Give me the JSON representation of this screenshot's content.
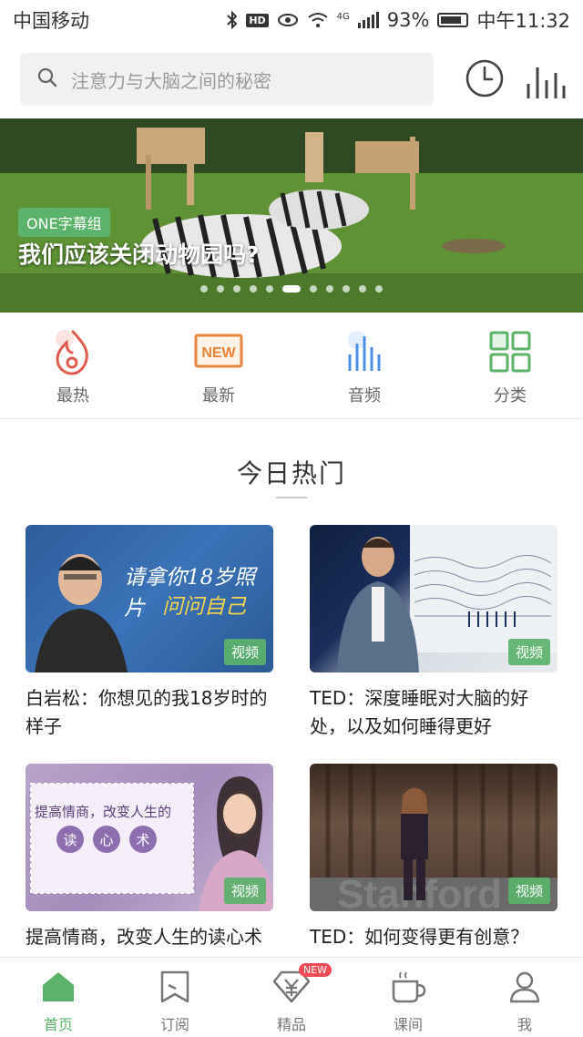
{
  "status_bar": {
    "carrier": "中国移动",
    "hd": "HD",
    "network": "4G",
    "battery": "93%",
    "time": "中午11:32"
  },
  "search": {
    "placeholder": "注意力与大脑之间的秘密"
  },
  "banner": {
    "tag": "ONE字幕组",
    "title": "我们应该关闭动物园吗?",
    "total_slides": 11,
    "active_slide": 5
  },
  "categories": [
    {
      "label": "最热",
      "icon": "flame-icon",
      "color": "#e05a4d"
    },
    {
      "label": "最新",
      "icon": "new-icon",
      "color": "#e8843a"
    },
    {
      "label": "音频",
      "icon": "audio-bars-icon",
      "color": "#4a8ee6"
    },
    {
      "label": "分类",
      "icon": "grid-icon",
      "color": "#5bb26a"
    }
  ],
  "section": {
    "title": "今日热门"
  },
  "cards": [
    {
      "title": "白岩松：你想见的我18岁时的样子",
      "badge": "视频",
      "thumb_text_1": "请拿你18岁照片",
      "thumb_text_2": "问问自己"
    },
    {
      "title": "TED：深度睡眠对大脑的好处，以及如何睡得更好",
      "badge": "视频"
    },
    {
      "title": "提高情商，改变人生的读心术",
      "badge": "视频",
      "thumb_text_1": "提高情商，改变人生的",
      "thumb_text_2": [
        "读",
        "心",
        "术"
      ]
    },
    {
      "title": "TED：如何变得更有创意？",
      "badge": "视频"
    }
  ],
  "tabbar": {
    "items": [
      {
        "label": "首页",
        "icon": "home-icon",
        "active": true
      },
      {
        "label": "订阅",
        "icon": "bookmark-icon",
        "active": false
      },
      {
        "label": "精品",
        "icon": "diamond-yen-icon",
        "active": false,
        "badge": "NEW"
      },
      {
        "label": "课间",
        "icon": "coffee-cup-icon",
        "active": false
      },
      {
        "label": "我",
        "icon": "user-icon",
        "active": false
      }
    ]
  },
  "colors": {
    "accent": "#5bb26a",
    "new_badge": "#f24b55"
  }
}
